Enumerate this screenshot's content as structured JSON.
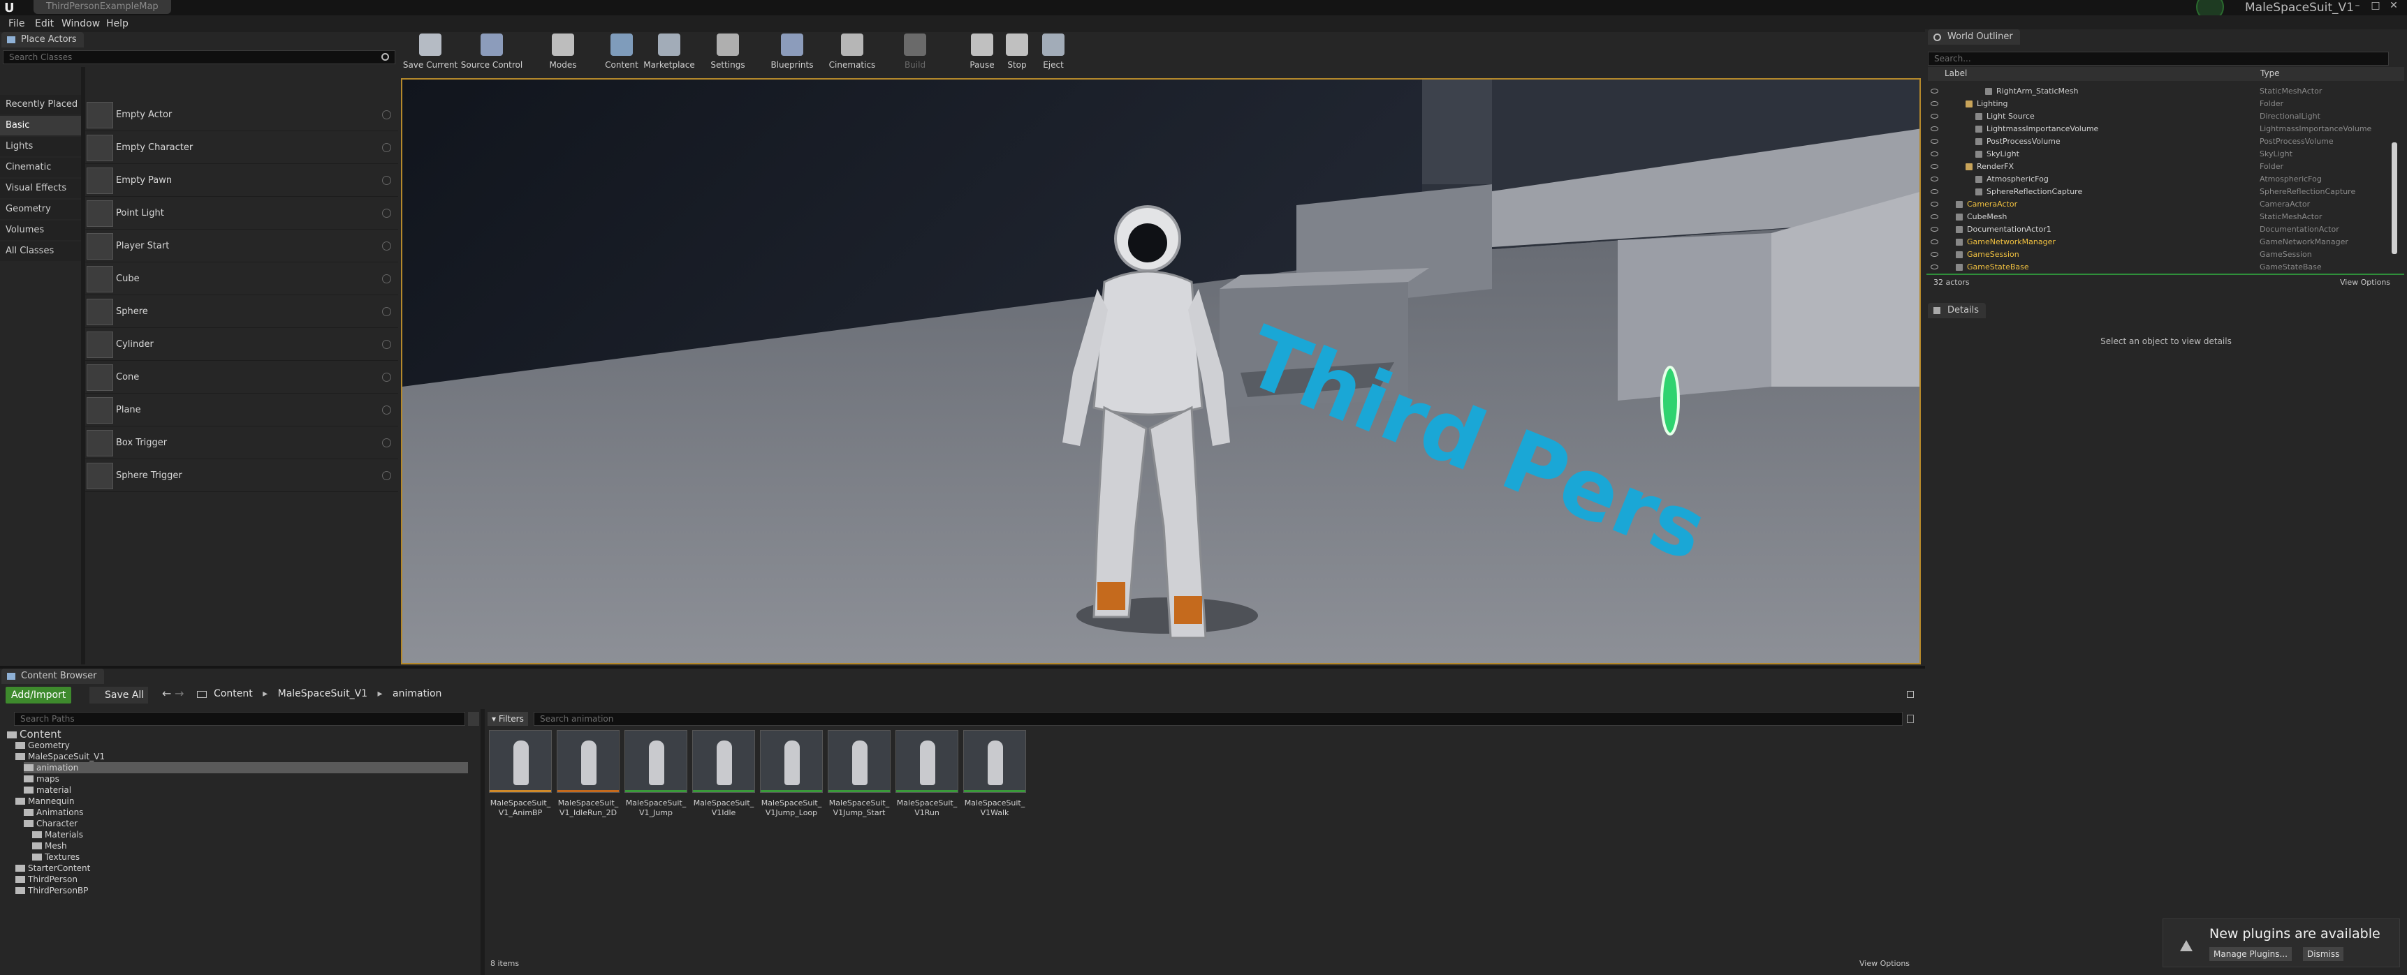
{
  "window": {
    "level_tab": "ThirdPersonExampleMap",
    "project_name": "MaleSpaceSuit_V1"
  },
  "menu": [
    "File",
    "Edit",
    "Window",
    "Help"
  ],
  "place_actors": {
    "tab_title": "Place Actors",
    "search_placeholder": "Search Classes",
    "categories": [
      "Recently Placed",
      "Basic",
      "Lights",
      "Cinematic",
      "Visual Effects",
      "Geometry",
      "Volumes",
      "All Classes"
    ],
    "selected_category": "Basic",
    "actors": [
      "Empty Actor",
      "Empty Character",
      "Empty Pawn",
      "Point Light",
      "Player Start",
      "Cube",
      "Sphere",
      "Cylinder",
      "Cone",
      "Plane",
      "Box Trigger",
      "Sphere Trigger"
    ]
  },
  "toolbar": {
    "buttons": [
      "Save Current",
      "Source Control",
      "Modes",
      "Content",
      "Marketplace",
      "Settings",
      "Blueprints",
      "Cinematics",
      "Build",
      "Pause",
      "Stop",
      "Eject"
    ]
  },
  "viewport": {
    "floor_text": "Third Pers"
  },
  "world_outliner": {
    "tab_title": "World Outliner",
    "search_placeholder": "Search...",
    "col_label": "Label",
    "col_type": "Type",
    "rows": [
      {
        "name": "RightArm_StaticMesh",
        "type": "StaticMeshActor",
        "indent": 3,
        "folder": false,
        "hl": false
      },
      {
        "name": "Lighting",
        "type": "Folder",
        "indent": 1,
        "folder": true,
        "hl": false
      },
      {
        "name": "Light Source",
        "type": "DirectionalLight",
        "indent": 2,
        "folder": false,
        "hl": false
      },
      {
        "name": "LightmassImportanceVolume",
        "type": "LightmassImportanceVolume",
        "indent": 2,
        "folder": false,
        "hl": false
      },
      {
        "name": "PostProcessVolume",
        "type": "PostProcessVolume",
        "indent": 2,
        "folder": false,
        "hl": false
      },
      {
        "name": "SkyLight",
        "type": "SkyLight",
        "indent": 2,
        "folder": false,
        "hl": false
      },
      {
        "name": "RenderFX",
        "type": "Folder",
        "indent": 1,
        "folder": true,
        "hl": false
      },
      {
        "name": "AtmosphericFog",
        "type": "AtmosphericFog",
        "indent": 2,
        "folder": false,
        "hl": false
      },
      {
        "name": "SphereReflectionCapture",
        "type": "SphereReflectionCapture",
        "indent": 2,
        "folder": false,
        "hl": false
      },
      {
        "name": "CameraActor",
        "type": "CameraActor",
        "indent": 0,
        "folder": false,
        "hl": true
      },
      {
        "name": "CubeMesh",
        "type": "StaticMeshActor",
        "indent": 0,
        "folder": false,
        "hl": false
      },
      {
        "name": "DocumentationActor1",
        "type": "DocumentationActor",
        "indent": 0,
        "folder": false,
        "hl": false
      },
      {
        "name": "GameNetworkManager",
        "type": "GameNetworkManager",
        "indent": 0,
        "folder": false,
        "hl": true
      },
      {
        "name": "GameSession",
        "type": "GameSession",
        "indent": 0,
        "folder": false,
        "hl": true
      },
      {
        "name": "GameStateBase",
        "type": "GameStateBase",
        "indent": 0,
        "folder": false,
        "hl": true
      }
    ],
    "count": "32 actors",
    "view_options": "View Options"
  },
  "details": {
    "tab_title": "Details",
    "empty_message": "Select an object to view details"
  },
  "content_browser": {
    "tab_title": "Content Browser",
    "add_import": "Add/Import",
    "save_all": "Save All",
    "breadcrumb": [
      "Content",
      "MaleSpaceSuit_V1",
      "animation"
    ],
    "search_paths_placeholder": "Search Paths",
    "filters_label": "Filters",
    "search_assets_placeholder": "Search animation",
    "tree": [
      {
        "label": "Content",
        "indent": 0,
        "selected": false,
        "big": true
      },
      {
        "label": "Geometry",
        "indent": 1,
        "selected": false,
        "big": false
      },
      {
        "label": "MaleSpaceSuit_V1",
        "indent": 1,
        "selected": false,
        "big": false
      },
      {
        "label": "animation",
        "indent": 2,
        "selected": true,
        "big": false
      },
      {
        "label": "maps",
        "indent": 2,
        "selected": false,
        "big": false
      },
      {
        "label": "material",
        "indent": 2,
        "selected": false,
        "big": false
      },
      {
        "label": "Mannequin",
        "indent": 1,
        "selected": false,
        "big": false
      },
      {
        "label": "Animations",
        "indent": 2,
        "selected": false,
        "big": false
      },
      {
        "label": "Character",
        "indent": 2,
        "selected": false,
        "big": false
      },
      {
        "label": "Materials",
        "indent": 3,
        "selected": false,
        "big": false
      },
      {
        "label": "Mesh",
        "indent": 3,
        "selected": false,
        "big": false
      },
      {
        "label": "Textures",
        "indent": 3,
        "selected": false,
        "big": false
      },
      {
        "label": "StarterContent",
        "indent": 1,
        "selected": false,
        "big": false
      },
      {
        "label": "ThirdPerson",
        "indent": 1,
        "selected": false,
        "big": false
      },
      {
        "label": "ThirdPersonBP",
        "indent": 1,
        "selected": false,
        "big": false
      }
    ],
    "assets": [
      {
        "line1": "MaleSpaceSuit_",
        "line2": "V1_AnimBP"
      },
      {
        "line1": "MaleSpaceSuit_",
        "line2": "V1_IdleRun_2D"
      },
      {
        "line1": "MaleSpaceSuit_",
        "line2": "V1_Jump"
      },
      {
        "line1": "MaleSpaceSuit_",
        "line2": "V1Idle"
      },
      {
        "line1": "MaleSpaceSuit_",
        "line2": "V1Jump_Loop"
      },
      {
        "line1": "MaleSpaceSuit_",
        "line2": "V1Jump_Start"
      },
      {
        "line1": "MaleSpaceSuit_",
        "line2": "V1Run"
      },
      {
        "line1": "MaleSpaceSuit_",
        "line2": "V1Walk"
      }
    ],
    "item_count": "8 items",
    "view_options": "View Options"
  },
  "notification": {
    "message": "New plugins are available",
    "manage_label": "Manage Plugins...",
    "dismiss_label": "Dismiss"
  },
  "colors": {
    "accent_gold": "#b5892b",
    "outliner_highlight": "#f0c040",
    "floor_text": "#1aa7d6",
    "add_button_green": "#3e8a2d"
  }
}
